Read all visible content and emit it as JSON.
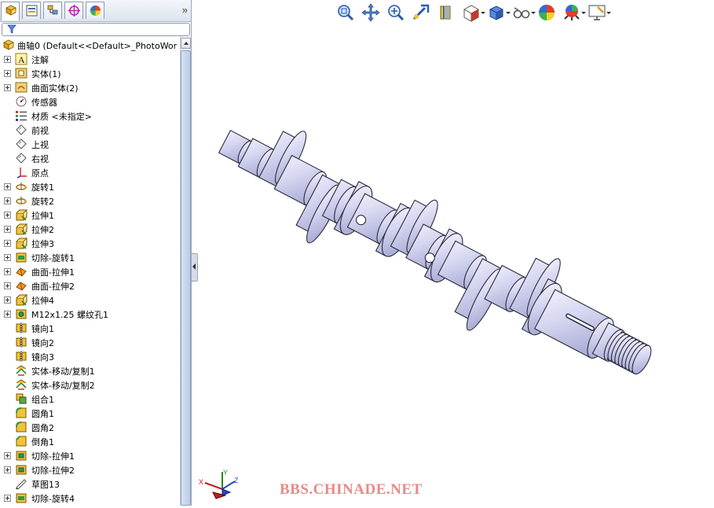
{
  "tabs": {
    "items": [
      {
        "name": "feature-manager-tab",
        "icon": "feature-tree-icon"
      },
      {
        "name": "property-manager-tab",
        "icon": "property-icon"
      },
      {
        "name": "configuration-manager-tab",
        "icon": "configuration-icon"
      },
      {
        "name": "dimxpert-tab",
        "icon": "crosshair-icon"
      },
      {
        "name": "display-manager-tab",
        "icon": "appearance-icon"
      }
    ],
    "more_label": "»"
  },
  "tree": {
    "root_label": "曲轴0  (Default<<Default>_PhotoWor",
    "items": [
      {
        "label": "注解",
        "icon": "annotation-icon",
        "expandable": true
      },
      {
        "label": "实体(1)",
        "icon": "solid-bodies-icon",
        "expandable": true
      },
      {
        "label": "曲面实体(2)",
        "icon": "surface-bodies-icon",
        "expandable": true
      },
      {
        "label": "传感器",
        "icon": "sensor-icon",
        "expandable": false
      },
      {
        "label": "材质 <未指定>",
        "icon": "material-icon",
        "expandable": false
      },
      {
        "label": "前视",
        "icon": "plane-icon",
        "expandable": false
      },
      {
        "label": "上视",
        "icon": "plane-icon",
        "expandable": false
      },
      {
        "label": "右视",
        "icon": "plane-icon",
        "expandable": false
      },
      {
        "label": "原点",
        "icon": "origin-icon",
        "expandable": false
      },
      {
        "label": "旋转1",
        "icon": "revolve-icon",
        "expandable": true
      },
      {
        "label": "旋转2",
        "icon": "revolve-icon",
        "expandable": true
      },
      {
        "label": "拉伸1",
        "icon": "extrude-icon",
        "expandable": true
      },
      {
        "label": "拉伸2",
        "icon": "extrude-icon",
        "expandable": true
      },
      {
        "label": "拉伸3",
        "icon": "extrude-icon",
        "expandable": true
      },
      {
        "label": "切除-旋转1",
        "icon": "cut-revolve-icon",
        "expandable": true
      },
      {
        "label": "曲面-拉伸1",
        "icon": "surface-extrude-icon",
        "expandable": true
      },
      {
        "label": "曲面-拉伸2",
        "icon": "surface-extrude-icon",
        "expandable": true
      },
      {
        "label": "拉伸4",
        "icon": "extrude-icon",
        "expandable": true
      },
      {
        "label": "M12x1.25 螺纹孔1",
        "icon": "hole-wizard-icon",
        "expandable": true
      },
      {
        "label": "镜向1",
        "icon": "mirror-icon",
        "expandable": false
      },
      {
        "label": "镜向2",
        "icon": "mirror-icon",
        "expandable": false
      },
      {
        "label": "镜向3",
        "icon": "mirror-icon",
        "expandable": false
      },
      {
        "label": "实体-移动/复制1",
        "icon": "move-copy-icon",
        "expandable": false
      },
      {
        "label": "实体-移动/复制2",
        "icon": "move-copy-icon",
        "expandable": false
      },
      {
        "label": "组合1",
        "icon": "combine-icon",
        "expandable": false
      },
      {
        "label": "圆角1",
        "icon": "fillet-icon",
        "expandable": false
      },
      {
        "label": "圆角2",
        "icon": "fillet-icon",
        "expandable": false
      },
      {
        "label": "倒角1",
        "icon": "chamfer-icon",
        "expandable": false
      },
      {
        "label": "切除-拉伸1",
        "icon": "cut-extrude-icon",
        "expandable": true
      },
      {
        "label": "切除-拉伸2",
        "icon": "cut-extrude-icon",
        "expandable": true
      },
      {
        "label": "草图13",
        "icon": "sketch-icon",
        "expandable": false
      },
      {
        "label": "切除-旋转4",
        "icon": "cut-revolve-icon",
        "expandable": true
      }
    ]
  },
  "toolbar": {
    "buttons": [
      {
        "name": "zoom-to-fit-button",
        "icon": "zoom-fit-icon",
        "dropdown": false
      },
      {
        "name": "pan-button",
        "icon": "pan-icon",
        "dropdown": false
      },
      {
        "name": "zoom-area-button",
        "icon": "zoom-area-icon",
        "dropdown": false
      },
      {
        "name": "previous-view-button",
        "icon": "previous-view-icon",
        "dropdown": false
      },
      {
        "name": "section-view-button",
        "icon": "section-view-icon",
        "dropdown": false
      },
      {
        "name": "view-orientation-button",
        "icon": "view-orientation-icon",
        "dropdown": true
      },
      {
        "name": "display-style-button",
        "icon": "display-style-icon",
        "dropdown": true
      },
      {
        "name": "hide-show-button",
        "icon": "hide-show-icon",
        "dropdown": true
      },
      {
        "name": "edit-appearance-button",
        "icon": "appearance-icon",
        "dropdown": false
      },
      {
        "name": "apply-scene-button",
        "icon": "scene-icon",
        "dropdown": true
      },
      {
        "name": "view-settings-button",
        "icon": "view-settings-icon",
        "dropdown": true
      }
    ]
  },
  "viewport": {
    "model_name": "crankshaft-model",
    "watermark": "BBS.CHINADE.NET",
    "triad": {
      "x": "X",
      "y": "Y",
      "z": "Z"
    }
  },
  "colors": {
    "model_fill": "#d8d9f2",
    "model_edge": "#2a2a3a",
    "watermark": "#e88a86",
    "panel_border": "#9aa6b8"
  }
}
